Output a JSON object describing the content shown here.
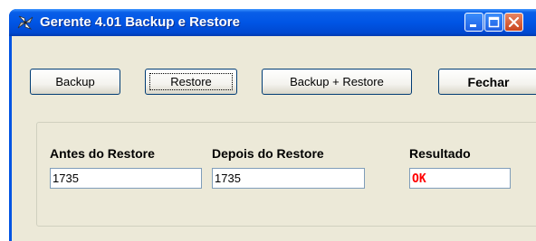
{
  "window": {
    "title": "Gerente 4.01 Backup e Restore",
    "icon": "pinwheel-app-icon",
    "controls": [
      "minimize",
      "maximize",
      "close"
    ]
  },
  "toolbar": {
    "backup_label": "Backup",
    "restore_label": "Restore",
    "backup_restore_label": "Backup + Restore",
    "close_label": "Fechar"
  },
  "results": {
    "before_label": "Antes do Restore",
    "before_value": "1735",
    "after_label": "Depois do Restore",
    "after_value": "1735",
    "result_label": "Resultado",
    "result_value": "OK",
    "result_color": "#ff0000"
  },
  "colors": {
    "titlebar": "#0055e5",
    "client_bg": "#ece9d8",
    "button_border": "#003c74",
    "close_button": "#c9451f"
  }
}
